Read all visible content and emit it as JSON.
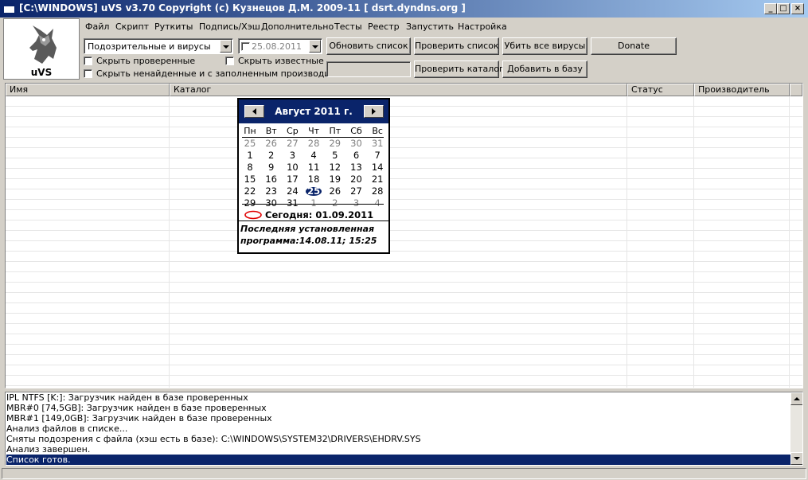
{
  "window": {
    "title": "[C:\\WINDOWS] uVS v3.70 Copyright (c) Кузнецов Д.М. 2009-11 [ dsrt.dyndns.org ]",
    "minimize": "_",
    "maximize": "□",
    "close": "×"
  },
  "logo": {
    "text": "uVS"
  },
  "menu": [
    "Файл",
    "Скрипт",
    "Руткиты",
    "Подпись/Хэш",
    "Дополнительно",
    "Тесты",
    "Реестр",
    "Запустить",
    "Настройка"
  ],
  "toolbar": {
    "filter_value": "Подозрительные и вирусы",
    "date_value": "25.08.2011",
    "refresh_label": "Обновить список",
    "check_list_label": "Проверить список",
    "kill_label": "Убить все вирусы",
    "donate_label": "Donate",
    "check_dir_label": "Проверить каталог",
    "add_db_label": "Добавить в базу",
    "hide_checked": "Скрыть проверенные",
    "hide_known": "Скрыть известные",
    "hide_not_found": "Скрыть ненайденные и с заполненным производителем"
  },
  "list": {
    "columns": [
      "Имя",
      "Каталог",
      "Статус",
      "Производитель"
    ]
  },
  "calendar": {
    "month_title": "Август 2011 г.",
    "weekdays": [
      "Пн",
      "Вт",
      "Ср",
      "Чт",
      "Пт",
      "Сб",
      "Вс"
    ],
    "weeks": [
      [
        "25",
        "26",
        "27",
        "28",
        "29",
        "30",
        "31"
      ],
      [
        "1",
        "2",
        "3",
        "4",
        "5",
        "6",
        "7"
      ],
      [
        "8",
        "9",
        "10",
        "11",
        "12",
        "13",
        "14"
      ],
      [
        "15",
        "16",
        "17",
        "18",
        "19",
        "20",
        "21"
      ],
      [
        "22",
        "23",
        "24",
        "25",
        "26",
        "27",
        "28"
      ],
      [
        "29",
        "30",
        "31",
        "1",
        "2",
        "3",
        "4"
      ]
    ],
    "selected_day": "25",
    "today_label": "Сегодня: 01.09.2011",
    "last_installed": "Последняя установленная программа:14.08.11; 15:25",
    "accent_color": "#0a246a",
    "today_marker_color": "#e00000"
  },
  "log": {
    "lines": [
      "IPL NTFS [K:]: Загрузчик найден в базе проверенных",
      "MBR#0 [74,5GB]: Загрузчик найден в базе проверенных",
      "MBR#1 [149,0GB]: Загрузчик найден в базе проверенных",
      "Анализ файлов в списке...",
      "Сняты подозрения с файла (хэш есть в базе): C:\\WINDOWS\\SYSTEM32\\DRIVERS\\EHDRV.SYS",
      "Анализ завершен.",
      "Список готов."
    ],
    "selected_index": 6
  }
}
